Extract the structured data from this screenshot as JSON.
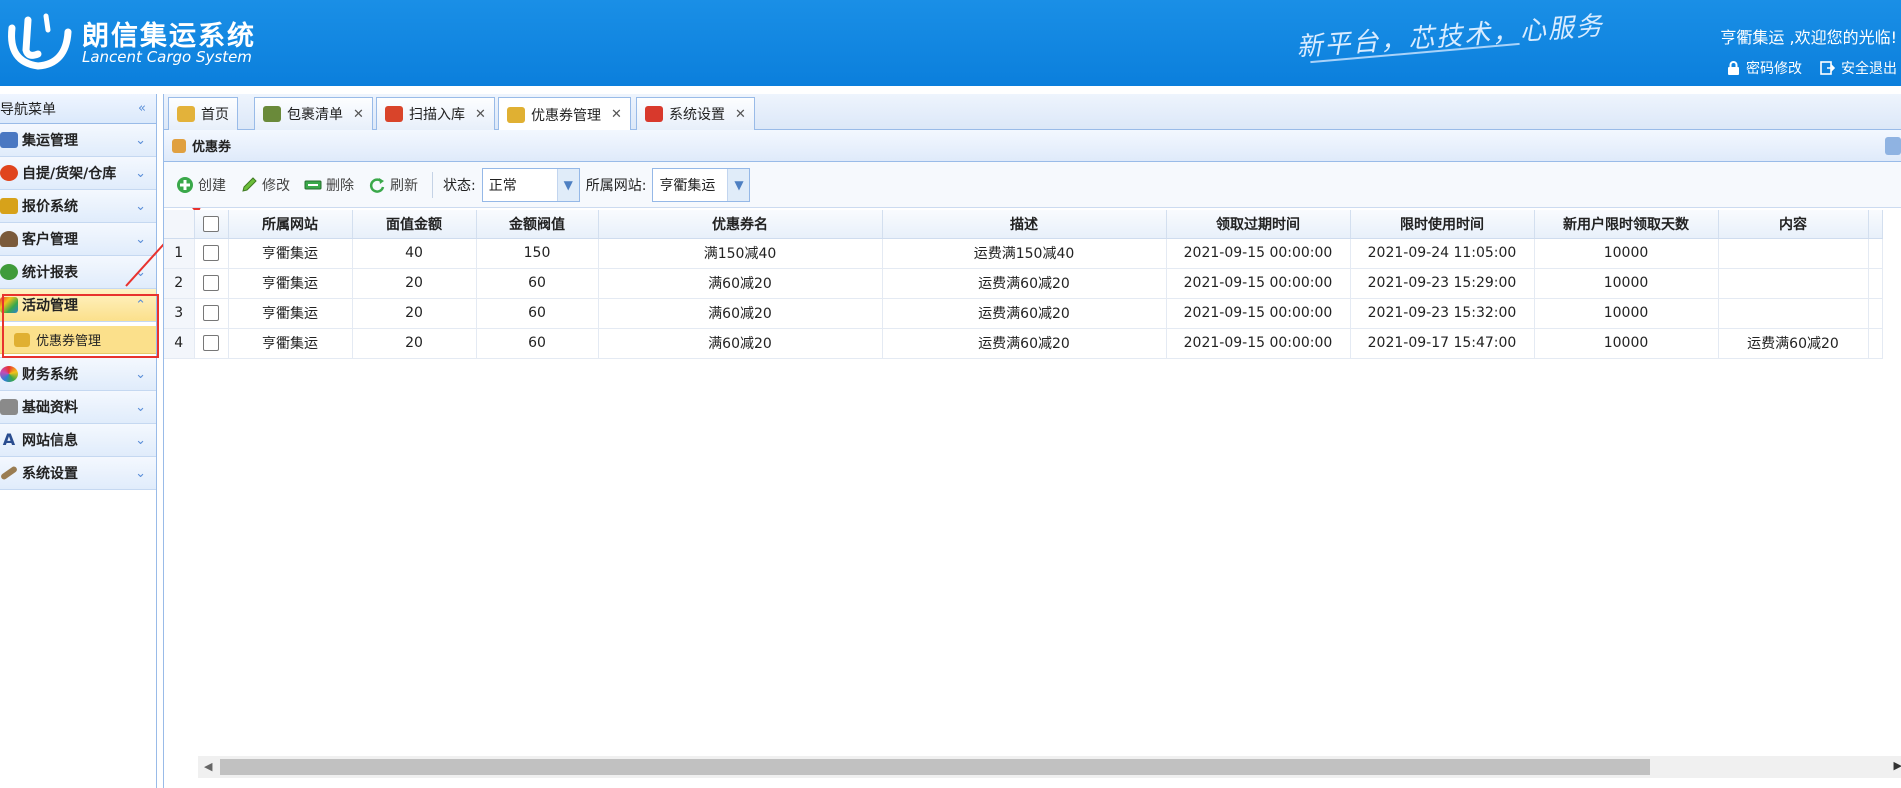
{
  "header": {
    "title": "朗信集运系统",
    "subtitle": "Lancent Cargo System",
    "slogan": "新平台，芯技术，心服务",
    "welcome": "亨衢集运 ,欢迎您的光临!",
    "links": [
      "密码修改",
      "安全退出"
    ]
  },
  "sidebar": {
    "title": "导航菜单",
    "items": [
      {
        "label": "集运管理",
        "icon": "monitor-icon",
        "color": "#4a78c2"
      },
      {
        "label": "自提/货架/仓库",
        "icon": "red-ball-icon",
        "color": "#e0441d"
      },
      {
        "label": "报价系统",
        "icon": "coins-icon",
        "color": "#d7a21a"
      },
      {
        "label": "客户管理",
        "icon": "user-icon",
        "color": "#7a5a3b"
      },
      {
        "label": "统计报表",
        "icon": "globe-icon",
        "color": "#3f9b3a"
      },
      {
        "label": "活动管理",
        "icon": "rainbow-icon",
        "color": "#e07a1a"
      },
      {
        "label": "财务系统",
        "icon": "color-wheel-icon",
        "color": "#c74bb4"
      },
      {
        "label": "基础资料",
        "icon": "database-icon",
        "color": "#8a8a8a"
      },
      {
        "label": "网站信息",
        "icon": "letter-a-icon",
        "color": "#2a4d8f"
      },
      {
        "label": "系统设置",
        "icon": "wrench-icon",
        "color": "#9a7d52"
      }
    ],
    "sub_item": "优惠券管理"
  },
  "tabs": [
    {
      "label": "首页",
      "closable": false
    },
    {
      "label": "包裹清单",
      "closable": true
    },
    {
      "label": "扫描入库",
      "closable": true
    },
    {
      "label": "优惠券管理",
      "closable": true,
      "active": true
    },
    {
      "label": "系统设置",
      "closable": true
    }
  ],
  "panel": {
    "title": "优惠券"
  },
  "toolbar": {
    "create": "创建",
    "edit": "修改",
    "delete": "删除",
    "refresh": "刷新",
    "status_label": "状态:",
    "status_value": "正常",
    "site_label": "所属网站:",
    "site_value": "亨衢集运"
  },
  "grid": {
    "columns": [
      "所属网站",
      "面值金额",
      "金额阀值",
      "优惠券名",
      "描述",
      "领取过期时间",
      "限时使用时间",
      "新用户限时领取天数",
      "内容"
    ],
    "rows": [
      {
        "num": "1",
        "cells": [
          "亨衢集运",
          "40",
          "150",
          "满150减40",
          "运费满150减40",
          "2021-09-15 00:00:00",
          "2021-09-24 11:05:00",
          "10000",
          ""
        ]
      },
      {
        "num": "2",
        "cells": [
          "亨衢集运",
          "20",
          "60",
          "满60减20",
          "运费满60减20",
          "2021-09-15 00:00:00",
          "2021-09-23 15:29:00",
          "10000",
          ""
        ]
      },
      {
        "num": "3",
        "cells": [
          "亨衢集运",
          "20",
          "60",
          "满60减20",
          "运费满60减20",
          "2021-09-15 00:00:00",
          "2021-09-23 15:32:00",
          "10000",
          ""
        ]
      },
      {
        "num": "4",
        "cells": [
          "亨衢集运",
          "20",
          "60",
          "满60减20",
          "运费满60减20",
          "2021-09-15 00:00:00",
          "2021-09-17 15:47:00",
          "10000",
          "运费满60减20"
        ]
      }
    ]
  }
}
